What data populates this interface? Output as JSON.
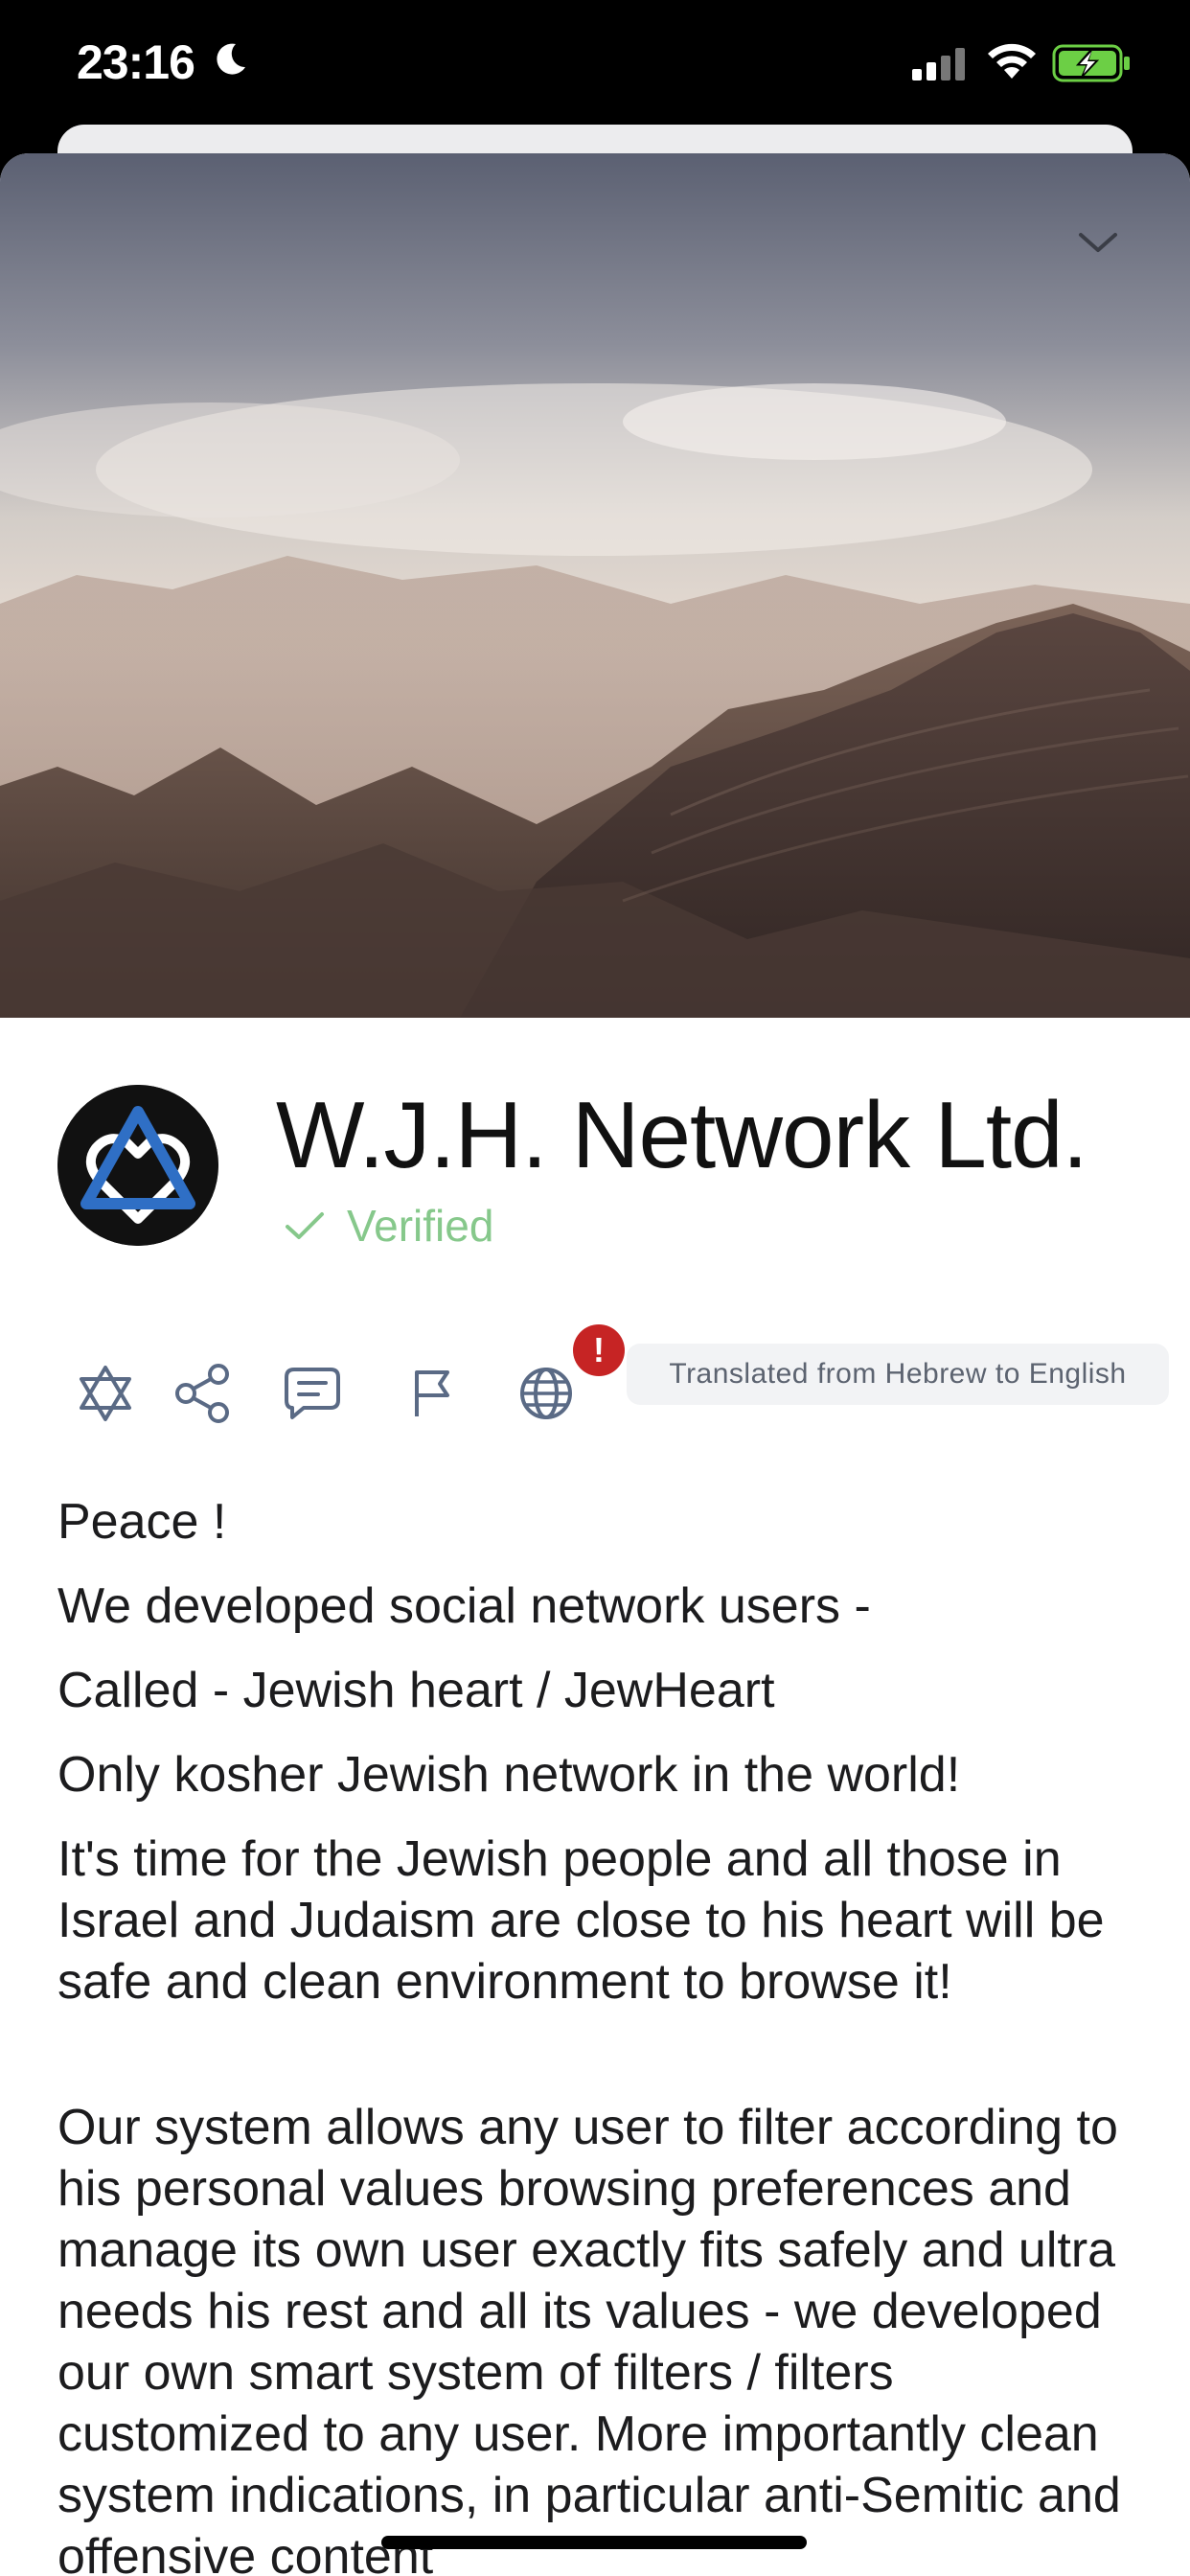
{
  "status_bar": {
    "time": "23:16",
    "icons": [
      "moon-icon",
      "signal-icon",
      "wifi-icon",
      "battery-charging-icon"
    ]
  },
  "org": {
    "name": "W.J.H. Network Ltd.",
    "verified_label": "Verified"
  },
  "actions": {
    "icons": [
      "star-of-david-icon",
      "share-icon",
      "chat-icon",
      "flag-icon",
      "globe-icon"
    ],
    "alert_badge": "!",
    "translation_note": "Translated from Hebrew to English"
  },
  "description": {
    "paragraphs": [
      "Peace !",
      " We developed social network users -",
      " Called - Jewish heart / JewHeart",
      " Only kosher Jewish network in the world!",
      " It's time for the Jewish people and all those in Israel and Judaism are close to his heart will be safe and clean environment to browse it!",
      " Our system allows any user to filter according to his personal values browsing preferences and manage its own user exactly fits safely and ultra needs his rest and all its values - we developed our own smart system of filters / filters customized to any user. More importantly clean system indications, in particular anti-Semitic and offensive content"
    ]
  },
  "colors": {
    "verified": "#86c88b",
    "alert": "#c62424",
    "icon_blue": "#5a6a85"
  }
}
